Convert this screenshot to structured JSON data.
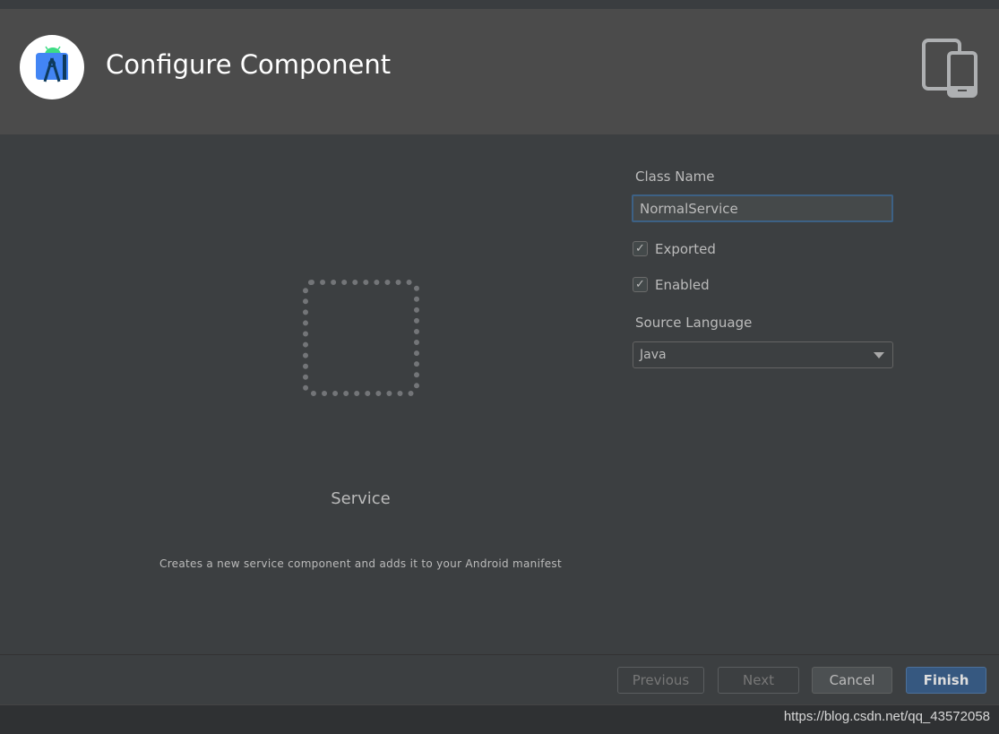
{
  "header": {
    "title": "Configure Component",
    "logo_icon": "android-studio-logo",
    "device_icon": "tablet-phone-icon"
  },
  "preview": {
    "component_name": "Service",
    "description": "Creates a new service component and adds it to your Android manifest"
  },
  "form": {
    "class_name_label": "Class Name",
    "class_name_value": "NormalService",
    "exported_label": "Exported",
    "exported_checked": true,
    "enabled_label": "Enabled",
    "enabled_checked": true,
    "source_language_label": "Source Language",
    "source_language_value": "Java",
    "check_glyph": "✓"
  },
  "buttons": {
    "previous": "Previous",
    "next": "Next",
    "cancel": "Cancel",
    "finish": "Finish"
  },
  "watermark": "https://blog.csdn.net/qq_43572058",
  "colors": {
    "accent": "#365880",
    "focus_border": "#3d6185"
  }
}
